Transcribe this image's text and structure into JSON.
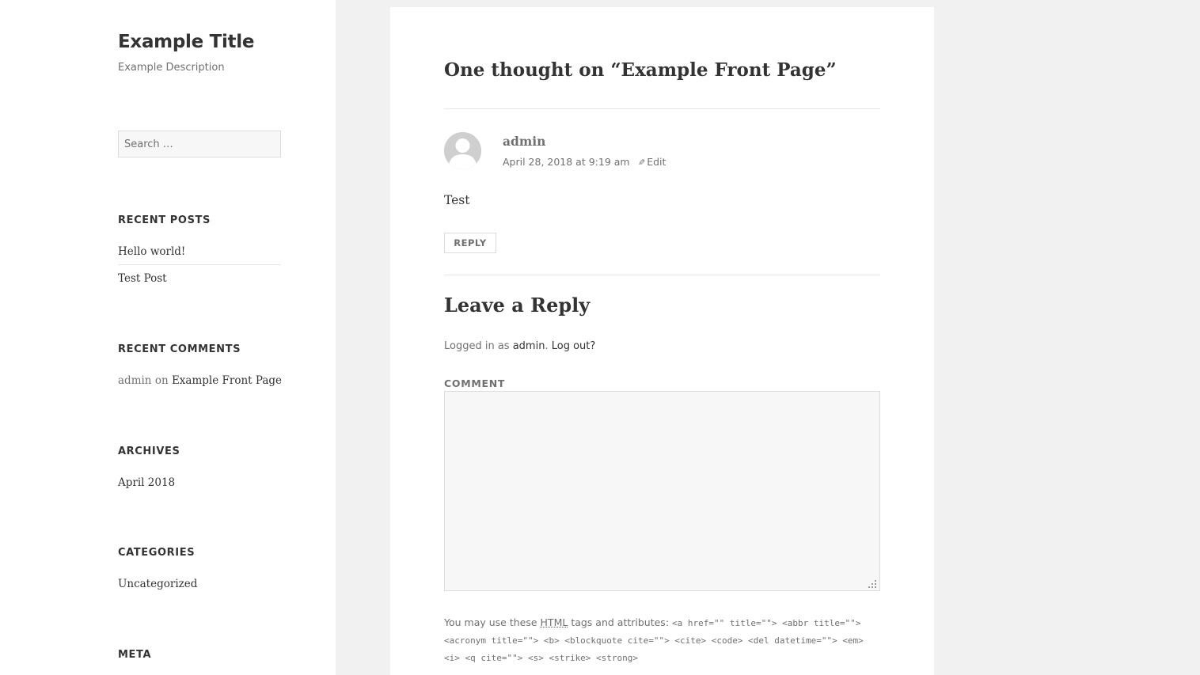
{
  "site": {
    "title": "Example Title",
    "description": "Example Description"
  },
  "search": {
    "placeholder": "Search …"
  },
  "widgets": {
    "recent_posts": {
      "title": "RECENT POSTS",
      "items": [
        "Hello world!",
        "Test Post"
      ]
    },
    "recent_comments": {
      "title": "RECENT COMMENTS",
      "author": "admin",
      "on": "on",
      "post": "Example Front Page"
    },
    "archives": {
      "title": "ARCHIVES",
      "items": [
        "April 2018"
      ]
    },
    "categories": {
      "title": "CATEGORIES",
      "items": [
        "Uncategorized"
      ]
    },
    "meta": {
      "title": "META"
    }
  },
  "comments": {
    "title": "One thought on “Example Front Page”",
    "items": [
      {
        "author": "admin",
        "date": "April 28, 2018 at 9:19 am",
        "edit_label": "Edit",
        "body": "Test",
        "reply_label": "REPLY"
      }
    ]
  },
  "reply_form": {
    "title": "Leave a Reply",
    "logged_in_prefix": "Logged in as",
    "user_link": "admin",
    "logout_link": "Log out?",
    "comment_label": "COMMENT",
    "comment_value": "",
    "allowed_intro": "You may use these",
    "allowed_abbr": "HTML",
    "allowed_mid": "tags and attributes:",
    "allowed_code": "<a href=\"\" title=\"\"> <abbr title=\"\"> <acronym title=\"\"> <b> <blockquote cite=\"\"> <cite> <code> <del datetime=\"\"> <em> <i> <q cite=\"\"> <s> <strike> <strong>"
  },
  "colors": {
    "page_background": "#f1f1f1",
    "card_background": "#ffffff",
    "text_primary": "#333333",
    "text_secondary": "#707070",
    "border": "#dcdcdc",
    "input_background": "#f7f7f7"
  },
  "icons": {
    "avatar": "default-avatar-icon",
    "edit": "pencil-icon",
    "resize": "resize-grip-icon"
  }
}
